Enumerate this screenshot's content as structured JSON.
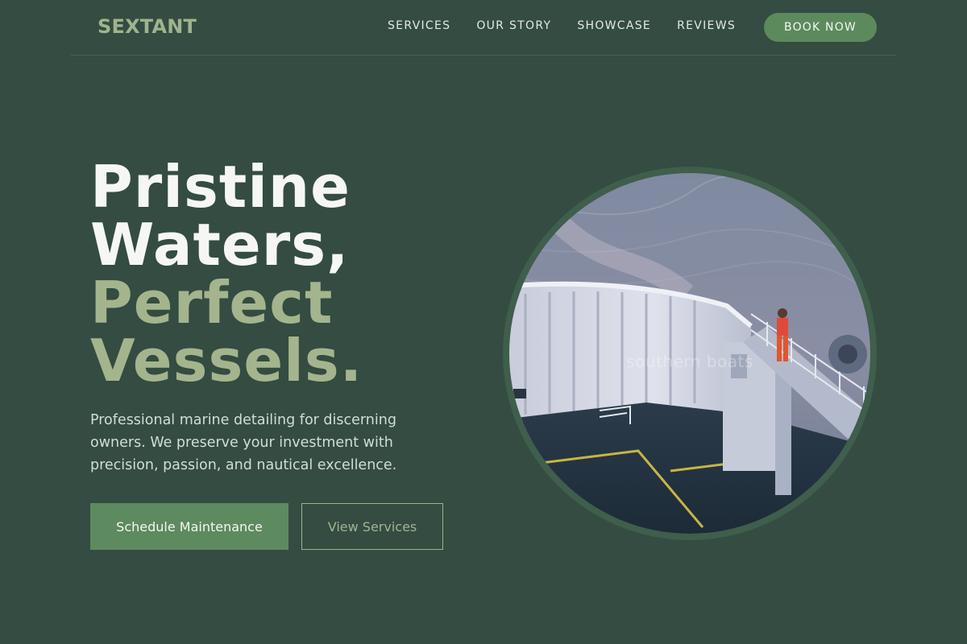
{
  "brand": {
    "logo": "SEXTANT"
  },
  "nav": {
    "links": [
      "SERVICES",
      "OUR STORY",
      "SHOWCASE",
      "REVIEWS"
    ],
    "cta": "BOOK NOW"
  },
  "hero": {
    "title_line1": "Pristine",
    "title_line2": "Waters,",
    "title_line3": "Perfect",
    "title_line4": "Vessels.",
    "description": "Professional marine detailing for discerning owners. We preserve your investment with precision, passion, and nautical excellence.",
    "primary_button": "Schedule Maintenance",
    "secondary_button": "View Services",
    "image_watermark": "southern boats"
  },
  "colors": {
    "background": "#344c41",
    "accent": "#5c8a5d",
    "accent_text": "#a4b48d"
  }
}
